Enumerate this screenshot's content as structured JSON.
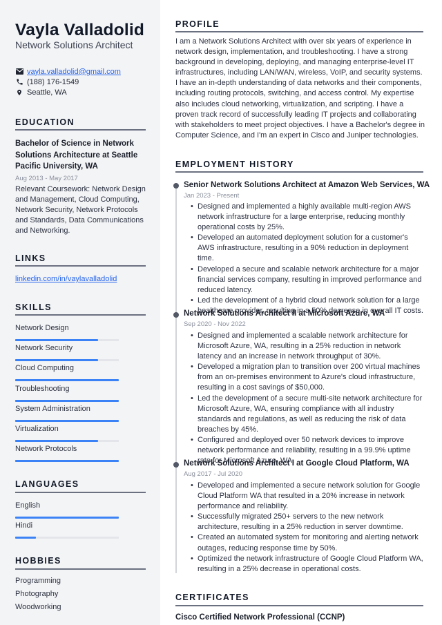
{
  "header": {
    "name": "Vayla Valladolid",
    "title": "Network Solutions Architect"
  },
  "contact": {
    "email": "vayla.valladolid@gmail.com",
    "phone": "(188) 176-1549",
    "location": "Seattle, WA",
    "icons": [
      "envelope-icon",
      "phone-icon",
      "map-pin-icon"
    ]
  },
  "education": {
    "heading": "EDUCATION",
    "degree": "Bachelor of Science in Network Solutions Architecture at Seattle Pacific University, WA",
    "dates": "Aug 2013 - May 2017",
    "coursework": "Relevant Coursework: Network Design and Management, Cloud Computing, Network Security, Network Protocols and Standards, Data Communications and Networking."
  },
  "links": {
    "heading": "LINKS",
    "items": [
      "linkedin.com/in/vaylavalladolid"
    ]
  },
  "skills": {
    "heading": "SKILLS",
    "items": [
      {
        "label": "Network Design",
        "level": 0.8
      },
      {
        "label": "Network Security",
        "level": 0.8
      },
      {
        "label": "Cloud Computing",
        "level": 1.0
      },
      {
        "label": "Troubleshooting",
        "level": 1.0
      },
      {
        "label": "System Administration",
        "level": 1.0
      },
      {
        "label": "Virtualization",
        "level": 0.8
      },
      {
        "label": "Network Protocols",
        "level": 1.0
      }
    ]
  },
  "languages": {
    "heading": "LANGUAGES",
    "items": [
      {
        "label": "English",
        "level": 1.0
      },
      {
        "label": "Hindi",
        "level": 0.2
      }
    ]
  },
  "hobbies": {
    "heading": "HOBBIES",
    "items": [
      "Programming",
      "Photography",
      "Woodworking"
    ]
  },
  "profile": {
    "heading": "PROFILE",
    "text": "I am a Network Solutions Architect with over six years of experience in network design, implementation, and troubleshooting. I have a strong background in developing, deploying, and managing enterprise-level IT infrastructures, including LAN/WAN, wireless, VoIP, and security systems. I have an in-depth understanding of data networks and their components, including routing protocols, switching, and access control. My expertise also includes cloud networking, virtualization, and scripting. I have a proven track record of successfully leading IT projects and collaborating with stakeholders to meet project objectives. I have a Bachelor's degree in Computer Science, and I'm an expert in Cisco and Juniper technologies."
  },
  "employment": {
    "heading": "EMPLOYMENT HISTORY",
    "jobs": [
      {
        "title": "Senior Network Solutions Architect at Amazon Web Services, WA",
        "dates": "Jan 2023 - Present",
        "bullets": [
          "Designed and implemented a highly available multi-region AWS network infrastructure for a large enterprise, reducing monthly operational costs by 25%.",
          "Developed an automated deployment solution for a customer's AWS infrastructure, resulting in a 90% reduction in deployment time.",
          "Developed a secure and scalable network architecture for a major financial services company, resulting in improved performance and reduced latency.",
          "Led the development of a hybrid cloud network solution for a large healthcare provider, resulting in a 50% decrease in overall IT costs."
        ]
      },
      {
        "title": "Network Solutions Architect II at Microsoft Azure, WA",
        "dates": "Sep 2020 - Nov 2022",
        "bullets": [
          "Designed and implemented a scalable network architecture for Microsoft Azure, WA, resulting in a 25% reduction in network latency and an increase in network throughput of 30%.",
          "Developed a migration plan to transition over 200 virtual machines from an on-premises environment to Azure's cloud infrastructure, resulting in a cost savings of $50,000.",
          "Led the development of a secure multi-site network architecture for Microsoft Azure, WA, ensuring compliance with all industry standards and regulations, as well as reducing the risk of data breaches by 45%.",
          "Configured and deployed over 50 network devices to improve network performance and reliability, resulting in a 99.9% uptime rate for Microsoft Azure, WA."
        ]
      },
      {
        "title": "Network Solutions Architect I at Google Cloud Platform, WA",
        "dates": "Aug 2017 - Jul 2020",
        "bullets": [
          "Developed and implemented a secure network solution for Google Cloud Platform WA that resulted in a 20% increase in network performance and reliability.",
          "Successfully migrated 250+ servers to the new network architecture, resulting in a 25% reduction in server downtime.",
          "Created an automated system for monitoring and alerting network outages, reducing response time by 50%.",
          "Optimized the network infrastructure of Google Cloud Platform WA, resulting in a 25% decrease in operational costs."
        ]
      }
    ]
  },
  "certificates": {
    "heading": "CERTIFICATES",
    "items": [
      "Cisco Certified Network Professional (CCNP)"
    ]
  },
  "colors": {
    "accent": "#3b82f6",
    "link": "#2563eb",
    "sidebar_bg": "#f3f4f6"
  }
}
